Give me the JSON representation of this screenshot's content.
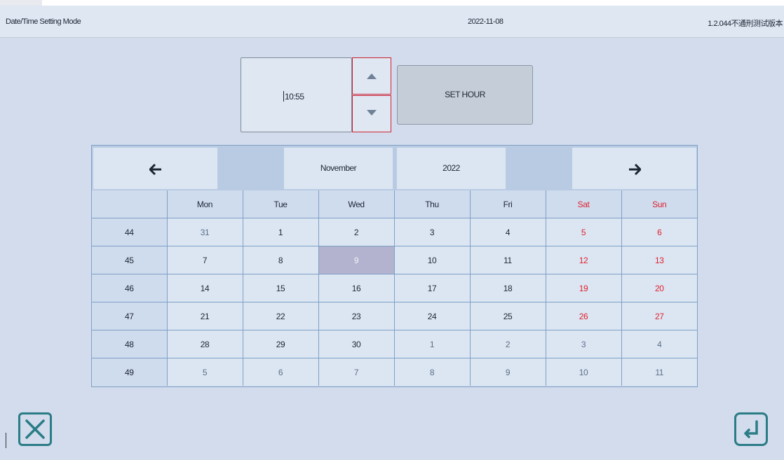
{
  "header": {
    "mode_title": "Date/Time Setting Mode",
    "date": "2022-11-08",
    "version": "1.2.044不通刑测试版本"
  },
  "time_setter": {
    "value": "10:55",
    "set_button_label": "SET HOUR",
    "icons": {
      "up": "triangle-up-icon",
      "down": "triangle-down-icon"
    }
  },
  "calendar": {
    "prev_label": "🡐",
    "next_label": "🡒",
    "month": "November",
    "year": "2022",
    "weekday_headers": [
      "",
      "Mon",
      "Tue",
      "Wed",
      "Thu",
      "Fri",
      "Sat",
      "Sun"
    ],
    "selected_day": "9",
    "weeks": [
      {
        "week": "44",
        "days": [
          "31",
          "1",
          "2",
          "3",
          "4",
          "5",
          "6"
        ]
      },
      {
        "week": "45",
        "days": [
          "7",
          "8",
          "9",
          "10",
          "11",
          "12",
          "13"
        ]
      },
      {
        "week": "46",
        "days": [
          "14",
          "15",
          "16",
          "17",
          "18",
          "19",
          "20"
        ]
      },
      {
        "week": "47",
        "days": [
          "21",
          "22",
          "23",
          "24",
          "25",
          "26",
          "27"
        ]
      },
      {
        "week": "48",
        "days": [
          "28",
          "29",
          "30",
          "1",
          "2",
          "3",
          "4"
        ]
      },
      {
        "week": "49",
        "days": [
          "5",
          "6",
          "7",
          "8",
          "9",
          "10",
          "11"
        ]
      }
    ]
  },
  "footer": {
    "cancel_icon": "close-box-icon",
    "confirm_icon": "enter-return-icon"
  },
  "colors": {
    "background": "#d2dcec",
    "weekend": "#e0202c",
    "selected": "#b3b3d0",
    "accent": "#2a7c86",
    "spin_border": "#d02030"
  }
}
